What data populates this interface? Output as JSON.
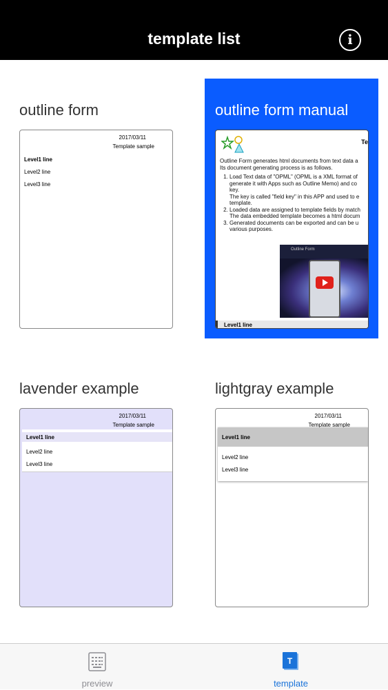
{
  "header": {
    "title": "template list",
    "info_icon": "info-icon",
    "info_glyph": "i"
  },
  "templates": [
    {
      "name": "outline form",
      "selected": false,
      "thumb": {
        "date": "2017/03/11",
        "subtitle": "Template sample",
        "level1": "Level1 line",
        "level2": "Level2 line",
        "level3": "Level3 line"
      }
    },
    {
      "name": "outline form manual",
      "selected": true,
      "thumb": {
        "heading": "Te",
        "intro": [
          "Outline Form generates html documents from text data a",
          "Its document generating process is as follows."
        ],
        "steps": [
          [
            "Load Text data of \"OPML\" (OPML is a XML format of",
            "generate it with Apps such as Outline Memo) and co",
            "key.",
            "The key is called \"field key\" in this APP and used to e",
            "template."
          ],
          [
            "Loaded data are assigned to template fields by match",
            "The data embedded template becomes a html docum"
          ],
          [
            "Generated documents can be exported and can be u",
            "various purposes."
          ]
        ],
        "video_caption": "Outline Form",
        "level1": "Level1 line"
      }
    },
    {
      "name": "lavender example",
      "selected": false,
      "thumb": {
        "date": "2017/03/11",
        "subtitle": "Template sample",
        "level1": "Level1 line",
        "level2": "Level2 line",
        "level3": "Level3 line"
      }
    },
    {
      "name": "lightgray example",
      "selected": false,
      "thumb": {
        "date": "2017/03/11",
        "subtitle": "Template sample",
        "level1": "Level1 line",
        "level2": "Level2 line",
        "level3": "Level3 line"
      }
    }
  ],
  "tabbar": {
    "items": [
      {
        "label": "preview",
        "icon": "keyboard-icon",
        "active": false
      },
      {
        "label": "template",
        "icon": "template-icon",
        "active": true
      }
    ]
  },
  "colors": {
    "accent": "#0a5cff",
    "lavender": "#e2e0fa",
    "lightgray": "#c6c6c6",
    "tab_active": "#1a73d9",
    "tab_inactive": "#8e8e93"
  }
}
